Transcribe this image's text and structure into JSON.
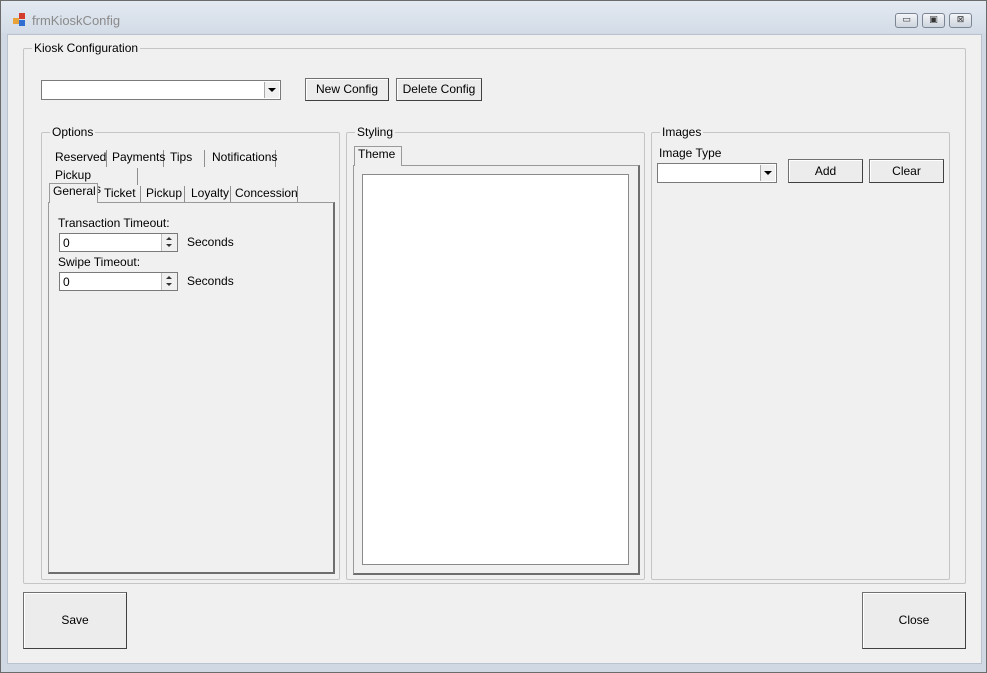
{
  "window": {
    "title": "frmKioskConfig",
    "controls": {
      "minimize": "▭",
      "maximize": "▣",
      "close": "⊠"
    }
  },
  "kiosk": {
    "group_label": "Kiosk Configuration",
    "config_select_value": "",
    "new_config_label": "New Config",
    "delete_config_label": "Delete Config"
  },
  "options": {
    "group_label": "Options",
    "tabs_row1": [
      "Reserved",
      "Payments",
      "Tips",
      "Notifications"
    ],
    "tabs_row2": [
      "Pickup Methods"
    ],
    "tabs_row3": [
      "General",
      "Ticket",
      "Pickup",
      "Loyalty",
      "Concession"
    ],
    "selected_tab": "General",
    "general": {
      "transaction_timeout_label": "Transaction Timeout:",
      "transaction_timeout_value": "0",
      "transaction_timeout_unit": "Seconds",
      "swipe_timeout_label": "Swipe Timeout:",
      "swipe_timeout_value": "0",
      "swipe_timeout_unit": "Seconds"
    }
  },
  "styling": {
    "group_label": "Styling",
    "tab": "Theme"
  },
  "images": {
    "group_label": "Images",
    "image_type_label": "Image Type",
    "image_type_value": "",
    "add_label": "Add",
    "clear_label": "Clear"
  },
  "footer": {
    "save_label": "Save",
    "close_label": "Close"
  },
  "colors": {
    "dialog_bg": "#f0f0f0",
    "title_text": "#8a8a8a",
    "group_border": "#c5c5c5"
  },
  "icons": {
    "app": "app-icon",
    "dropdown": "chevron-down-icon",
    "spin_up": "spin-up-icon",
    "spin_down": "spin-down-icon"
  }
}
